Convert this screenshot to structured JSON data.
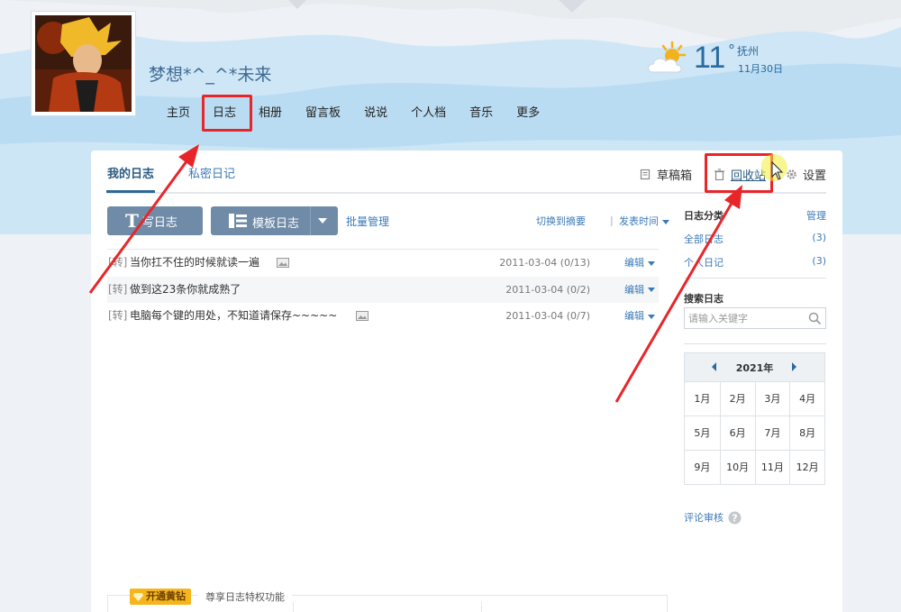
{
  "header": {
    "nickname": "梦想*^_^*未来",
    "nav": [
      "主页",
      "日志",
      "相册",
      "留言板",
      "说说",
      "个人档",
      "音乐",
      "更多"
    ],
    "active_nav": "日志"
  },
  "weather": {
    "temp": "11",
    "degree": "°",
    "city": "抚州",
    "date": "11月30日",
    "icon": "partly-cloudy-icon"
  },
  "tabs": {
    "mine": "我的日志",
    "private": "私密日记"
  },
  "tools": {
    "drafts": "草稿箱",
    "recycle": "回收站",
    "settings": "设置"
  },
  "toolbar": {
    "write": "写日志",
    "template": "模板日志",
    "batch": "批量管理",
    "switch": "切换到摘要",
    "divider": "|",
    "sort": "发表时间"
  },
  "posts": [
    {
      "tag": "[转]",
      "title": "当你扛不住的时候就读一遍",
      "has_image": true,
      "date": "2011-03-04",
      "counts": "(0/13)",
      "edit": "编辑"
    },
    {
      "tag": "[转]",
      "title": "做到这23条你就成熟了",
      "has_image": false,
      "date": "2011-03-04",
      "counts": "(0/2)",
      "edit": "编辑"
    },
    {
      "tag": "[转]",
      "title": "电脑每个键的用处，不知道请保存~~~~~",
      "has_image": true,
      "date": "2011-03-04",
      "counts": "(0/7)",
      "edit": "编辑"
    }
  ],
  "sidebar": {
    "category_title": "日志分类",
    "manage": "管理",
    "categories": [
      {
        "label": "全部日志",
        "count": "(3)"
      },
      {
        "label": "个人日记",
        "count": "(3)"
      }
    ],
    "search_title": "搜索日志",
    "search_placeholder": "请输入关键字",
    "calendar": {
      "year": "2021年",
      "months": [
        "1月",
        "2月",
        "3月",
        "4月",
        "5月",
        "6月",
        "7月",
        "8月",
        "9月",
        "10月",
        "11月",
        "12月"
      ]
    },
    "review": "评论审核"
  },
  "bottom": {
    "vip": "开通黄钻",
    "label": "尊享日志特权功能"
  },
  "colors": {
    "accent": "#3b7ab8",
    "button": "#6f8ba7",
    "annotation": "#e8262a",
    "sky": "#b9dcf2"
  }
}
